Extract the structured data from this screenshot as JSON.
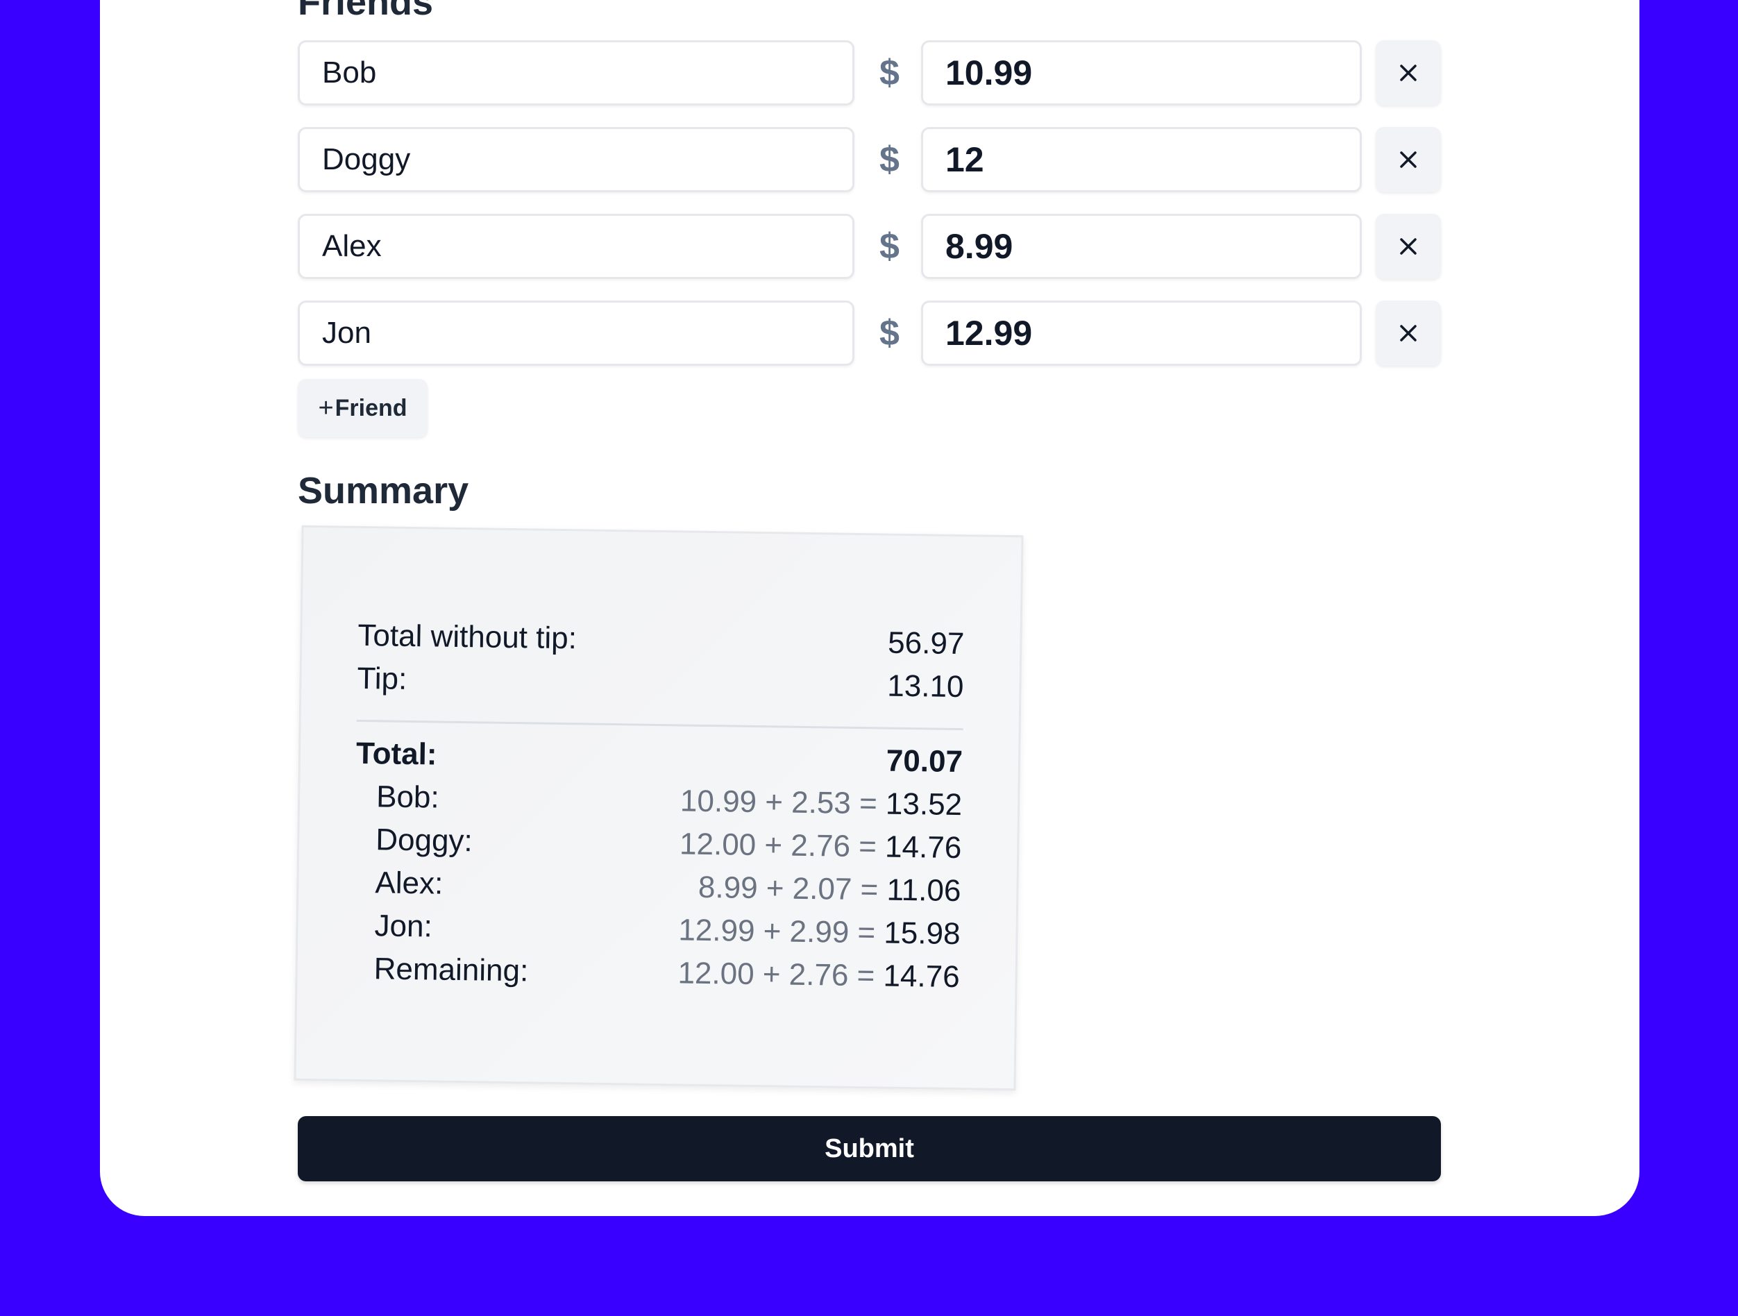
{
  "friends": {
    "title": "Friends",
    "rows": [
      {
        "name": "Bob",
        "currency": "$",
        "amount": "10.99"
      },
      {
        "name": "Doggy",
        "currency": "$",
        "amount": "12"
      },
      {
        "name": "Alex",
        "currency": "$",
        "amount": "8.99"
      },
      {
        "name": "Jon",
        "currency": "$",
        "amount": "12.99"
      }
    ],
    "add_plus": "+",
    "add_label": "Friend"
  },
  "summary": {
    "title": "Summary",
    "total_without_tip_label": "Total without tip:",
    "total_without_tip_value": "56.97",
    "tip_label": "Tip:",
    "tip_value": "13.10",
    "total_label": "Total:",
    "total_value": "70.07",
    "people": [
      {
        "label": "Bob:",
        "calc": "10.99 + 2.53 =",
        "value": "13.52"
      },
      {
        "label": "Doggy:",
        "calc": "12.00 + 2.76 =",
        "value": "14.76"
      },
      {
        "label": "Alex:",
        "calc": "8.99 + 2.07 =",
        "value": "11.06"
      },
      {
        "label": "Jon:",
        "calc": "12.99 + 2.99 =",
        "value": "15.98"
      },
      {
        "label": "Remaining:",
        "calc": "12.00 + 2.76 =",
        "value": "14.76"
      }
    ]
  },
  "submit_label": "Submit",
  "colors": {
    "background": "#3a00ff",
    "card": "#ffffff",
    "submit": "#111827",
    "dollar": "#64748b"
  }
}
